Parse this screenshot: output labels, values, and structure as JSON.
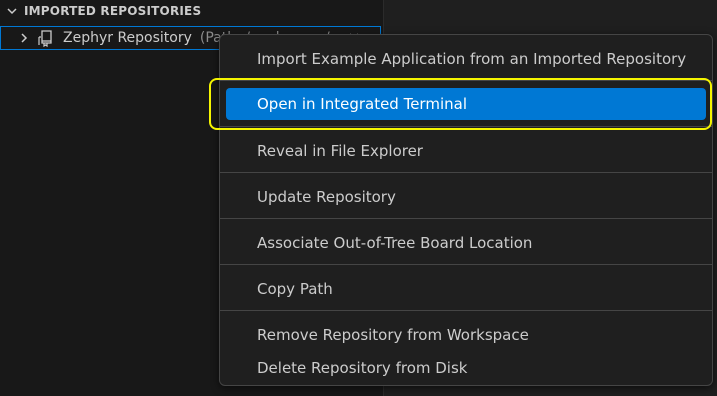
{
  "explorer": {
    "section_title": "IMPORTED REPOSITORIES",
    "tree": {
      "item_label": "Zephyr Repository",
      "item_description": "(Path: /workspace/..."
    }
  },
  "context_menu": {
    "items": [
      {
        "label": "Import Example Application from an Imported Repository"
      },
      {
        "label": "Open in Integrated Terminal"
      },
      {
        "label": "Reveal in File Explorer"
      },
      {
        "label": "Update Repository"
      },
      {
        "label": "Associate Out-of-Tree Board Location"
      },
      {
        "label": "Copy Path"
      },
      {
        "label": "Remove Repository from Workspace"
      },
      {
        "label": "Delete Repository from Disk"
      }
    ],
    "active_index": 1
  },
  "colors": {
    "accent": "#0078d4",
    "highlight_annotation": "#f5f500",
    "menu_background": "#1f1f1f",
    "sidebar_background": "#181818"
  },
  "icons": {
    "section_chevron": "chevron-down-icon",
    "tree_twisty": "chevron-right-icon",
    "repository": "repository-icon",
    "close": "close-icon"
  }
}
